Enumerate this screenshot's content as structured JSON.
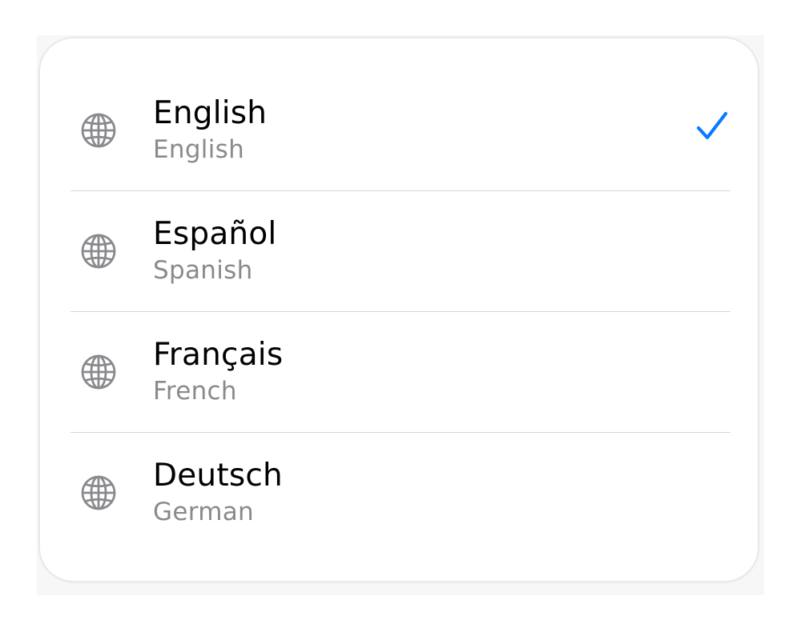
{
  "languages": [
    {
      "native": "English",
      "english": "English",
      "selected": true,
      "icon": "globe-icon"
    },
    {
      "native": "Español",
      "english": "Spanish",
      "selected": false,
      "icon": "globe-icon"
    },
    {
      "native": "Français",
      "english": "French",
      "selected": false,
      "icon": "globe-icon"
    },
    {
      "native": "Deutsch",
      "english": "German",
      "selected": false,
      "icon": "globe-icon"
    }
  ],
  "colors": {
    "accent": "#0a7aff",
    "secondary_text": "#8a8a8e",
    "icon": "#8a8a8e",
    "separator": "#d6d6da"
  }
}
